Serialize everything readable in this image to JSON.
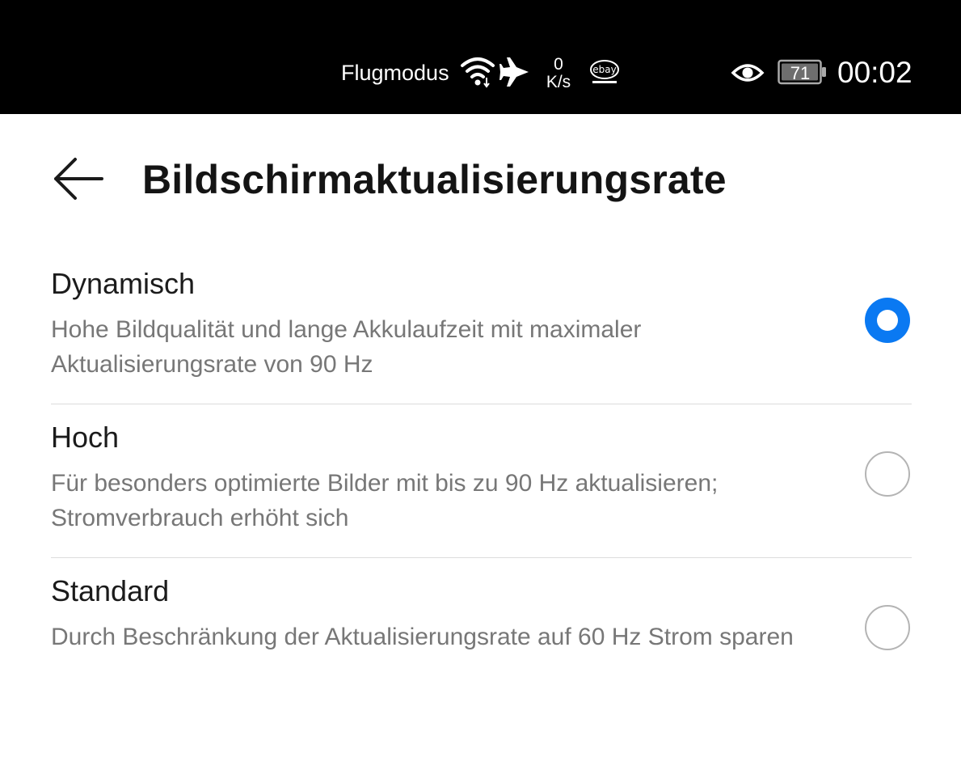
{
  "status_bar": {
    "carrier": "Flugmodus",
    "net_speed_value": "0",
    "net_speed_unit": "K/s",
    "ebay_label": "ebay",
    "battery_level": "71",
    "time": "00:02"
  },
  "header": {
    "title": "Bildschirmaktualisierungsrate"
  },
  "options": [
    {
      "title": "Dynamisch",
      "description": "Hohe Bildqualität und lange Akkulaufzeit mit maximaler Aktualisierungsrate von 90 Hz",
      "selected": true
    },
    {
      "title": "Hoch",
      "description": "Für besonders optimierte Bilder mit bis zu 90 Hz aktualisieren; Stromverbrauch erhöht sich",
      "selected": false
    },
    {
      "title": "Standard",
      "description": "Durch Beschränkung der Aktualisierungsrate auf 60 Hz Strom sparen",
      "selected": false
    }
  ],
  "colors": {
    "accent": "#0a79f2",
    "status_bar_bg": "#000000",
    "title_text": "#141414",
    "secondary_text": "#777777",
    "divider": "#dcdcdc"
  }
}
